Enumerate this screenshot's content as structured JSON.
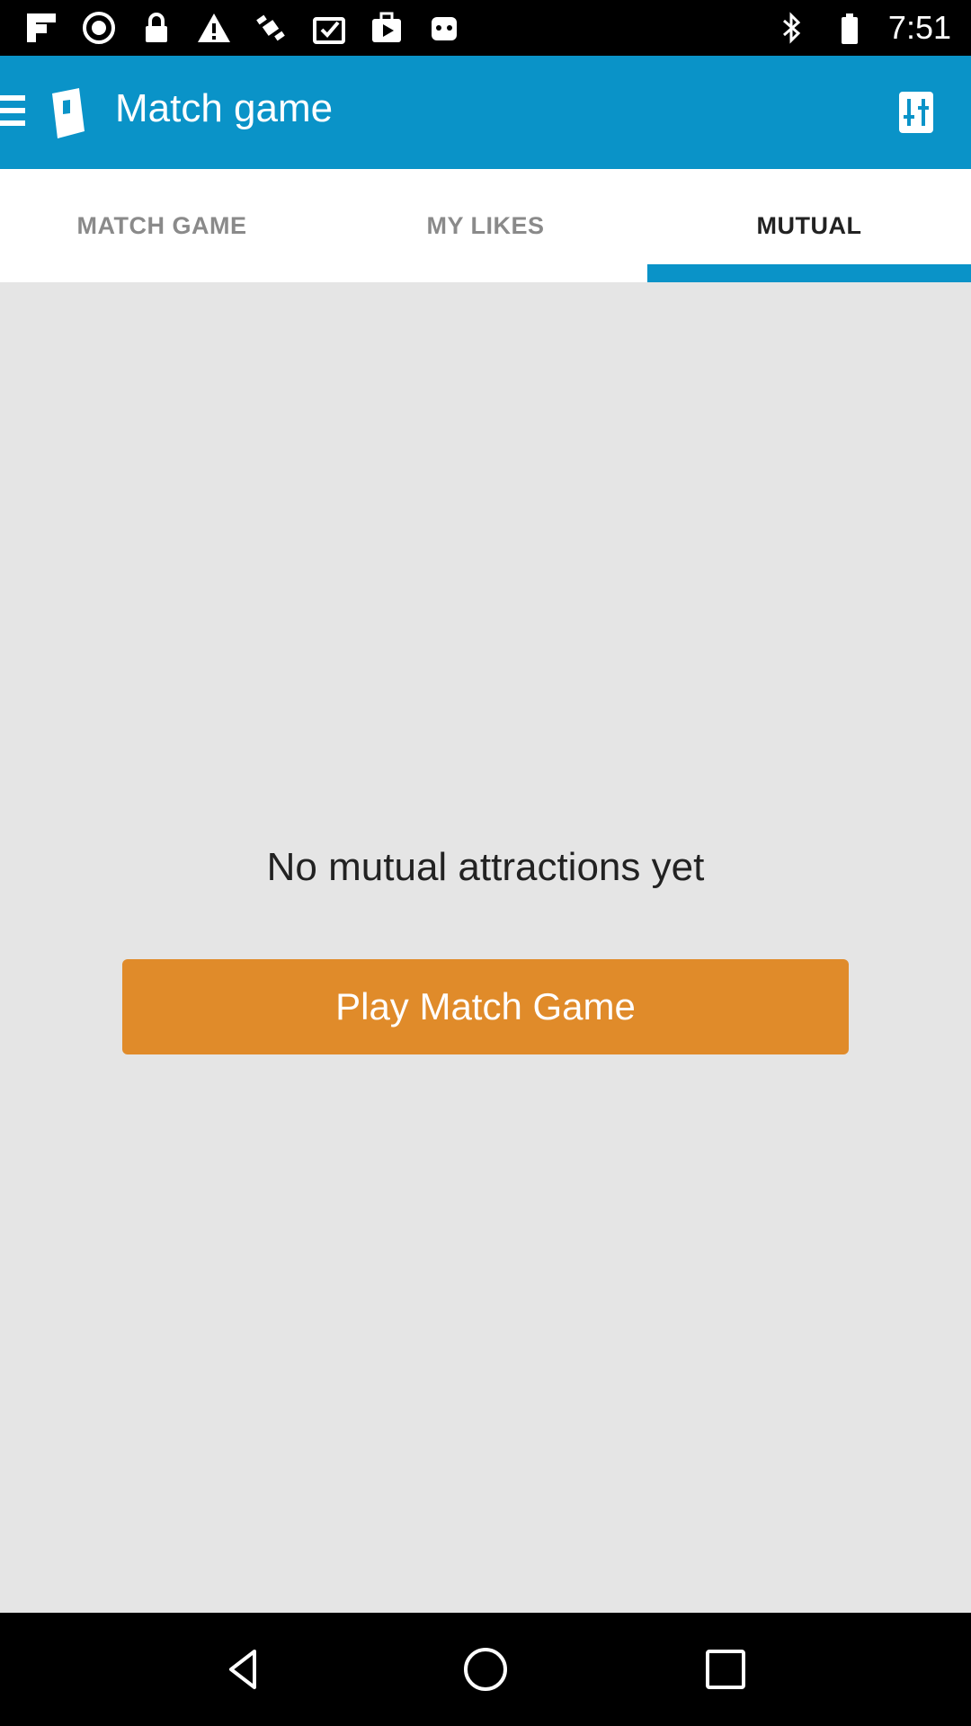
{
  "status_bar": {
    "time": "7:51",
    "icons_left": [
      "flipboard-icon",
      "circle-icon",
      "lock-icon",
      "warning-icon",
      "fake-gps-icon",
      "clipboard-check-icon",
      "play-store-icon",
      "android-icon"
    ],
    "icons_right": [
      "bluetooth-icon",
      "battery-icon"
    ]
  },
  "app_bar": {
    "title": "Match game",
    "background_color": "#0a93c8"
  },
  "tabs": [
    {
      "label": "MATCH GAME",
      "active": false
    },
    {
      "label": "MY LIKES",
      "active": false
    },
    {
      "label": "MUTUAL",
      "active": true
    }
  ],
  "content": {
    "empty_message": "No mutual attractions yet",
    "play_button_label": "Play Match Game",
    "play_button_color": "#e08b2a"
  },
  "nav_bar": {
    "buttons": [
      "back-icon",
      "home-icon",
      "recents-icon"
    ]
  }
}
